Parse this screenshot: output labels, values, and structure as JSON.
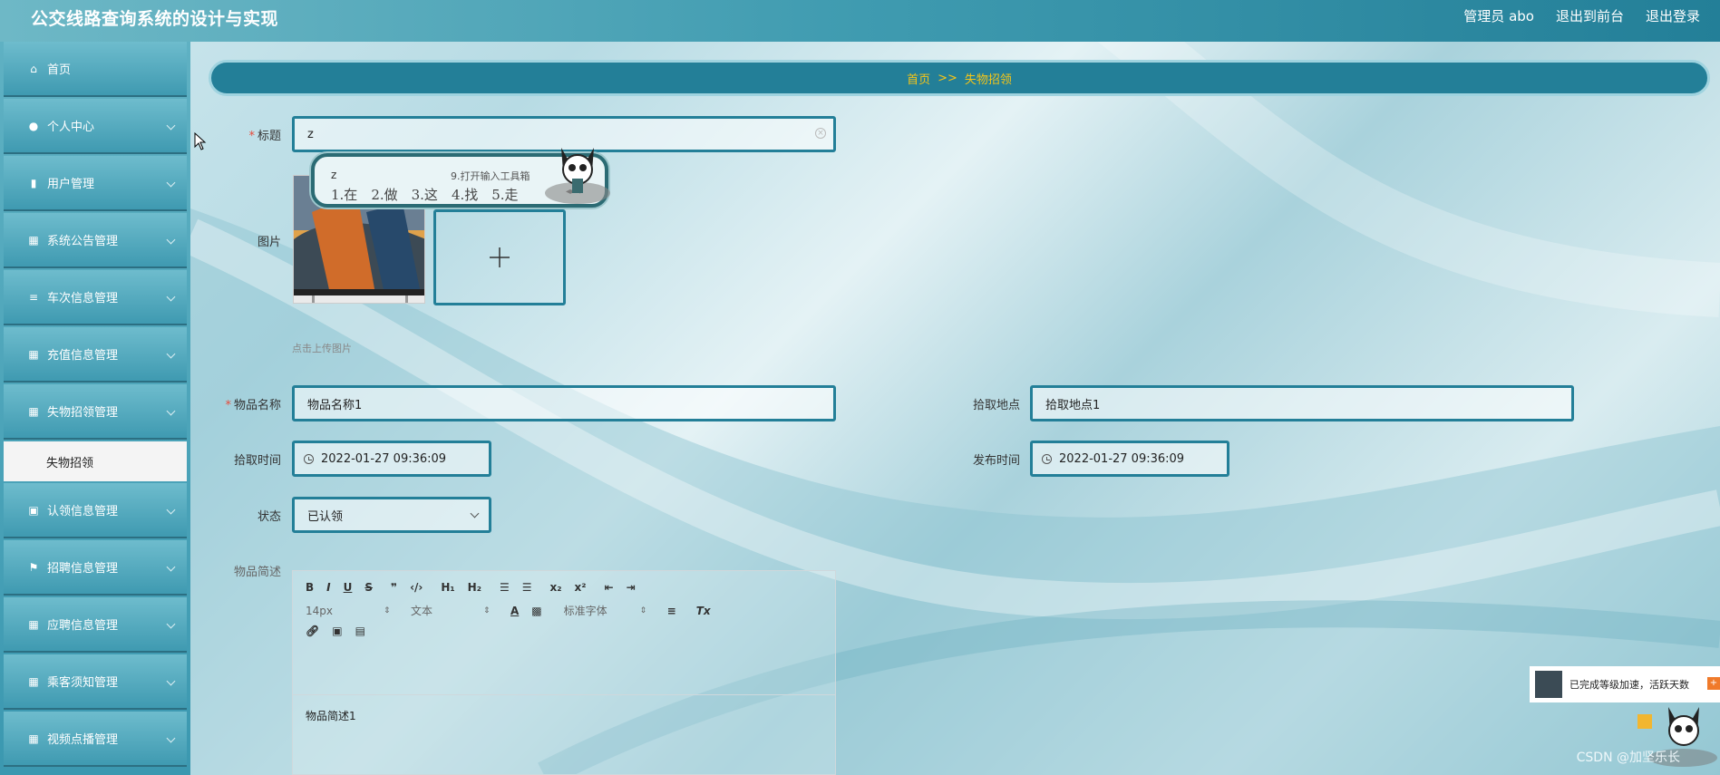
{
  "header": {
    "app_title": "公交线路查询系统的设计与实现",
    "links": [
      "管理员 abo",
      "退出到前台",
      "退出登录"
    ]
  },
  "sidebar": {
    "items": [
      {
        "label": "首页",
        "icon": "home-icon"
      },
      {
        "label": "个人中心",
        "icon": "user-icon"
      },
      {
        "label": "用户管理",
        "icon": "chart-icon"
      },
      {
        "label": "系统公告管理",
        "icon": "grid-icon"
      },
      {
        "label": "车次信息管理",
        "icon": "list-icon"
      },
      {
        "label": "充值信息管理",
        "icon": "apps-icon"
      },
      {
        "label": "失物招领管理",
        "icon": "grid-icon"
      },
      {
        "label": "认领信息管理",
        "icon": "clipboard-icon"
      },
      {
        "label": "招聘信息管理",
        "icon": "flag-icon"
      },
      {
        "label": "应聘信息管理",
        "icon": "grid-icon"
      },
      {
        "label": "乘客须知管理",
        "icon": "grid-icon"
      },
      {
        "label": "视频点播管理",
        "icon": "grid-icon"
      }
    ],
    "active_sub": "失物招领"
  },
  "breadcrumb": {
    "home": "首页",
    "sep": ">>",
    "current": "失物招领"
  },
  "form": {
    "title_label": "标题",
    "title_value": "z",
    "image_label": "图片",
    "upload_hint": "点击上传图片",
    "item_name_label": "物品名称",
    "item_name_value": "物品名称1",
    "pickup_place_label": "拾取地点",
    "pickup_place_value": "拾取地点1",
    "pickup_time_label": "拾取时间",
    "pickup_time_value": "2022-01-27 09:36:09",
    "publish_time_label": "发布时间",
    "publish_time_value": "2022-01-27 09:36:09",
    "status_label": "状态",
    "status_value": "已认领",
    "desc_label": "物品简述"
  },
  "editor": {
    "font_size": "14px",
    "paragraph": "文本",
    "font_family": "标准字体",
    "content": "物品简述1"
  },
  "ime": {
    "input": "z",
    "tool": "9.打开输入工具箱",
    "candidates": [
      "1.在",
      "2.做",
      "3.这",
      "4.找",
      "5.走"
    ]
  },
  "csdn": {
    "popup_text": "已完成等级加速，活跃天数",
    "badge": "+",
    "watermark": "CSDN @加坚乐长"
  },
  "colors": {
    "accent": "#237f98",
    "breadcrumb_text": "#f5c518",
    "required": "#e74c3c"
  }
}
